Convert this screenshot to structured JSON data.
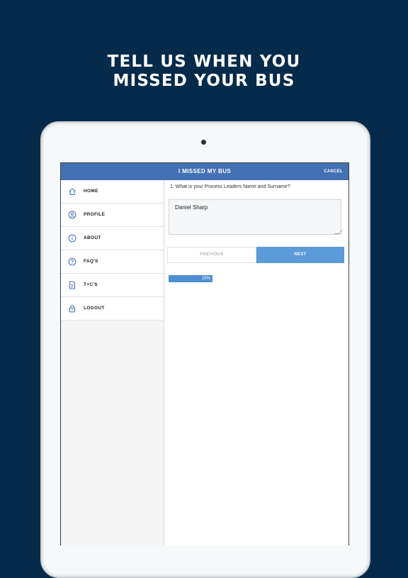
{
  "promo": {
    "line1": "TELL US WHEN YOU",
    "line2": "MISSED YOUR BUS"
  },
  "header": {
    "title": "I MISSED MY BUS",
    "cancel_label": "CANCEL"
  },
  "sidebar": {
    "items": [
      {
        "label": "HOME",
        "icon": "home-icon"
      },
      {
        "label": "PROFILE",
        "icon": "profile-icon"
      },
      {
        "label": "ABOUT",
        "icon": "info-icon"
      },
      {
        "label": "FAQ'S",
        "icon": "question-icon"
      },
      {
        "label": "T+C'S",
        "icon": "document-icon"
      },
      {
        "label": "LOGOUT",
        "icon": "lock-icon"
      }
    ]
  },
  "form": {
    "question": "1: What is your Process Leaders Name and Surname?",
    "answer_value": "Daniel Sharp",
    "previous_label": "PREVIOUS",
    "next_label": "NEXT",
    "progress_label": "25%",
    "progress_fraction": 0.25
  },
  "colors": {
    "background": "#062a4a",
    "header_bar": "#4471b4",
    "next_button": "#5b9bd9",
    "progress": "#4d8fd2"
  }
}
